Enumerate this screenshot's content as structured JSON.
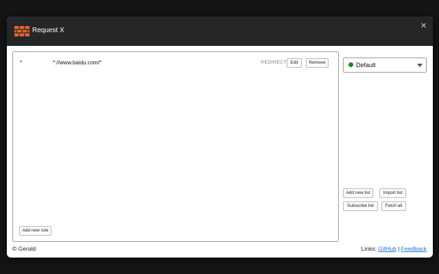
{
  "app": {
    "title": "Request X",
    "close_icon": "×"
  },
  "rules": [
    {
      "method": "*",
      "url": "*://www.baidu.com/*",
      "type": "REDIRECT",
      "edit_label": "Edit",
      "remove_label": "Remove"
    }
  ],
  "content": {
    "add_rule_label": "Add new rule"
  },
  "sidebar": {
    "selected_list": "Default",
    "status_color": "#1a8a1a",
    "add_list_label": "Add new list",
    "import_list_label": "Import list",
    "subscribe_list_label": "Subscribe list",
    "fetch_all_label": "Fetch all"
  },
  "footer": {
    "copyright": "© Gerald",
    "links_label": "Links:",
    "github_label": "GitHub",
    "separator": "|",
    "feedback_label": "Feedback"
  }
}
